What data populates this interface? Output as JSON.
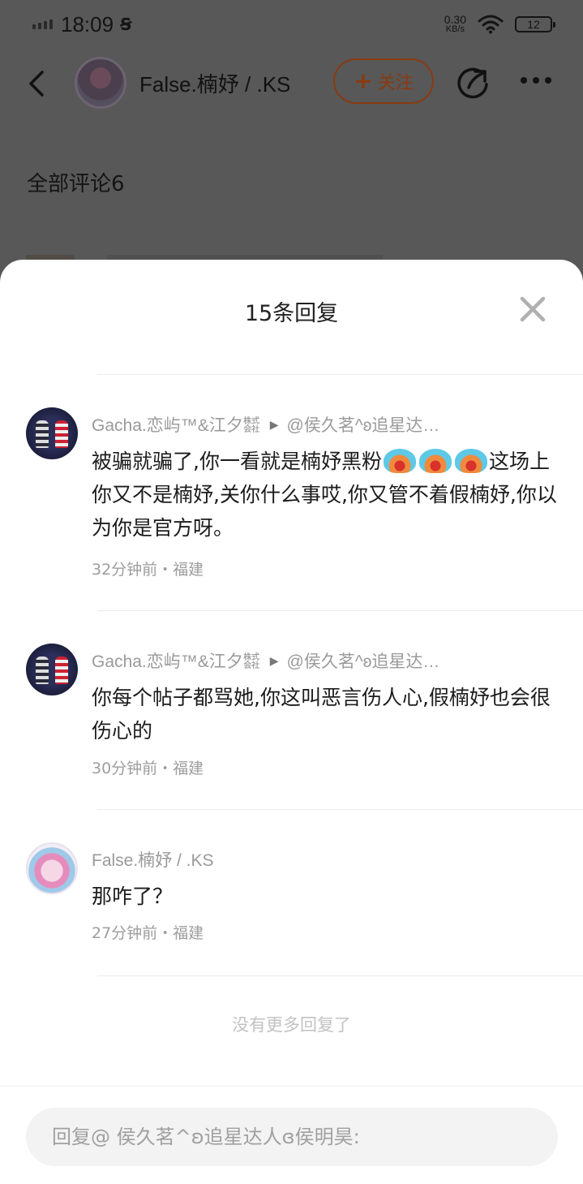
{
  "status_bar": {
    "time": "18:09",
    "silent_icon": "Ꞩ",
    "net_speed": "0.30",
    "net_unit": "KB/s",
    "battery": "12"
  },
  "top_bar": {
    "user_name": "False.楠妤 / .KS",
    "follow_label": "关注"
  },
  "comments_header": "全部评论6",
  "sheet": {
    "title": "15条回复",
    "replies": [
      {
        "author": "Gacha.恋屿™&江夕㍿",
        "reply_to": "@侯久茗^ʚ追星达…",
        "text_before_emoji": "被骗就骗了,你一看就是楠妤黑粉",
        "text_after_emoji": "这场上你又不是楠妤,关你什么事哎,你又管不着假楠妤,你以为你是官方呀。",
        "meta": "32分钟前・福建"
      },
      {
        "author": "Gacha.恋屿™&江夕㍿",
        "reply_to": "@侯久茗^ʚ追星达…",
        "text": "你每个帖子都骂她,你这叫恶言伤人心,假楠妤也会很伤心的",
        "meta": "30分钟前・福建"
      },
      {
        "author": "False.楠妤 / .KS",
        "text": "那咋了？",
        "meta": "27分钟前・福建"
      }
    ],
    "no_more": "没有更多回复了",
    "input_placeholder": "回复@ 侯久茗^ʚ追星达人ɞ侯明昊:"
  },
  "colors": {
    "accent_orange": "#ff6a13",
    "muted_text": "#9a9a9a",
    "overlay": "#585858"
  },
  "icons": [
    "back-icon",
    "share-icon",
    "more-icon",
    "close-icon",
    "wifi-icon",
    "signal-icon",
    "battery-icon"
  ]
}
